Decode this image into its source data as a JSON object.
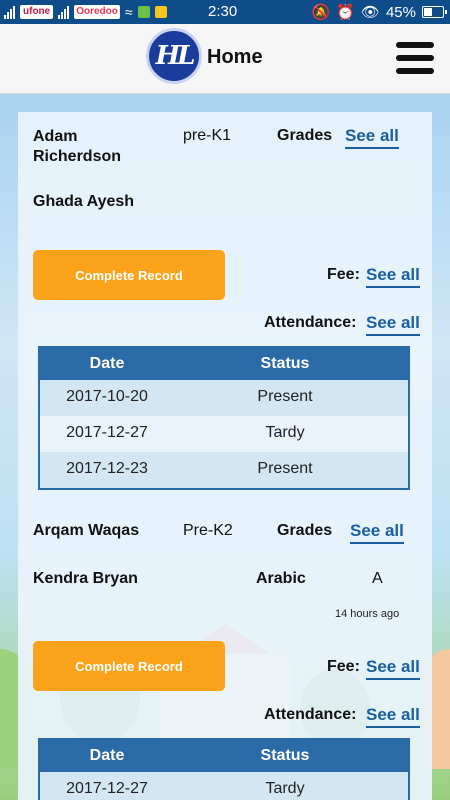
{
  "status_bar": {
    "carrier": "ufone",
    "carrier2": "Ooredoo",
    "time": "2:30",
    "battery": "45%",
    "battery_level": 0.45
  },
  "app_bar": {
    "logo_text": "HL",
    "title": "Home"
  },
  "students": [
    {
      "name": "Adam Richerdson",
      "class": "pre-K1",
      "grades_label": "Grades",
      "see_all": "See all",
      "subject_teacher": "Ghada Ayesh",
      "subject": "",
      "grade": "",
      "timestamp": "",
      "button": "Complete Record",
      "fee_label": "Fee:",
      "attendance_label": "Attendance:",
      "attendance_headers": [
        "Date",
        "Status"
      ],
      "attendance": [
        {
          "date": "2017-10-20",
          "status": "Present"
        },
        {
          "date": "2017-12-27",
          "status": "Tardy"
        },
        {
          "date": "2017-12-23",
          "status": "Present"
        }
      ]
    },
    {
      "name": "Arqam Waqas",
      "class": "Pre-K2",
      "grades_label": "Grades",
      "see_all": "See all",
      "subject_teacher": "Kendra  Bryan",
      "subject": "Arabic",
      "grade": "A",
      "timestamp": "14 hours ago",
      "button": "Complete Record",
      "fee_label": "Fee:",
      "attendance_label": "Attendance:",
      "attendance_headers": [
        "Date",
        "Status"
      ],
      "attendance": [
        {
          "date": "2017-12-27",
          "status": "Tardy"
        }
      ]
    }
  ]
}
